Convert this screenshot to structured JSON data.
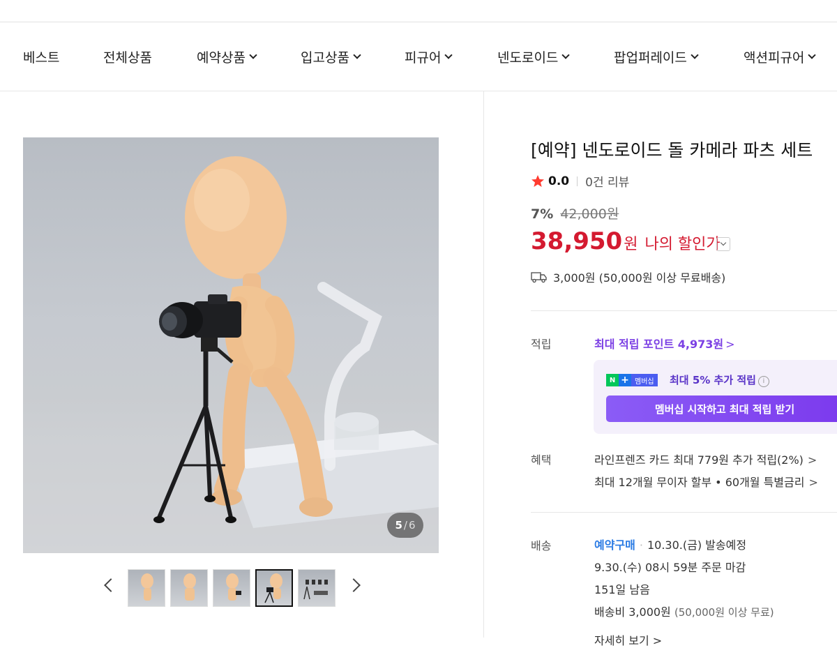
{
  "nav": {
    "items": [
      {
        "label": "베스트",
        "has_dropdown": false
      },
      {
        "label": "전체상품",
        "has_dropdown": false
      },
      {
        "label": "예약상품",
        "has_dropdown": true
      },
      {
        "label": "입고상품",
        "has_dropdown": true
      },
      {
        "label": "피규어",
        "has_dropdown": true
      },
      {
        "label": "넨도로이드",
        "has_dropdown": true
      },
      {
        "label": "팝업퍼레이드",
        "has_dropdown": true
      },
      {
        "label": "액션피규어",
        "has_dropdown": true
      }
    ]
  },
  "gallery": {
    "current": "5",
    "separator": "/",
    "total": "6",
    "active_thumb_index": 4,
    "thumb_count": 5
  },
  "product": {
    "title": "[예약] 넨도로이드 돌 카메라 파츠 세트",
    "rating": "0.0",
    "review_count": "0건 리뷰",
    "discount_pct": "7%",
    "original_price": "42,000원",
    "price": "38,950",
    "price_unit": "원",
    "my_price_label": "나의 할인가",
    "shipping_fee": "3,000원 (50,000원 이상 무료배송)"
  },
  "points": {
    "label": "적립",
    "max_points": "최대 적립 포인트 4,973원",
    "membership_badge_n": "N",
    "membership_badge_plus": "+",
    "membership_badge_text": "멤버십",
    "membership_extra": "최대 5% 추가 적립",
    "membership_button": "멤버십 시작하고 최대 적립 받기"
  },
  "benefits": {
    "label": "혜택",
    "items": [
      "라인프렌즈 카드 최대 779원 추가 적립(2%)",
      "최대 12개월 무이자 할부 • 60개월 특별금리"
    ]
  },
  "delivery": {
    "label": "배송",
    "preorder_tag": "예약구매",
    "ship_date": "10.30.(금) 발송예정",
    "deadline": "9.30.(수) 08시 59분 주문 마감",
    "remaining": "151일 남음",
    "fee": "배송비 3,000원",
    "fee_note": "(50,000원 이상 무료)",
    "detail_link": "자세히 보기"
  },
  "colors": {
    "price_red": "#d41a30",
    "points_purple": "#7b3fe4",
    "preorder_blue": "#2a7be4",
    "star": "#ff3b30"
  }
}
